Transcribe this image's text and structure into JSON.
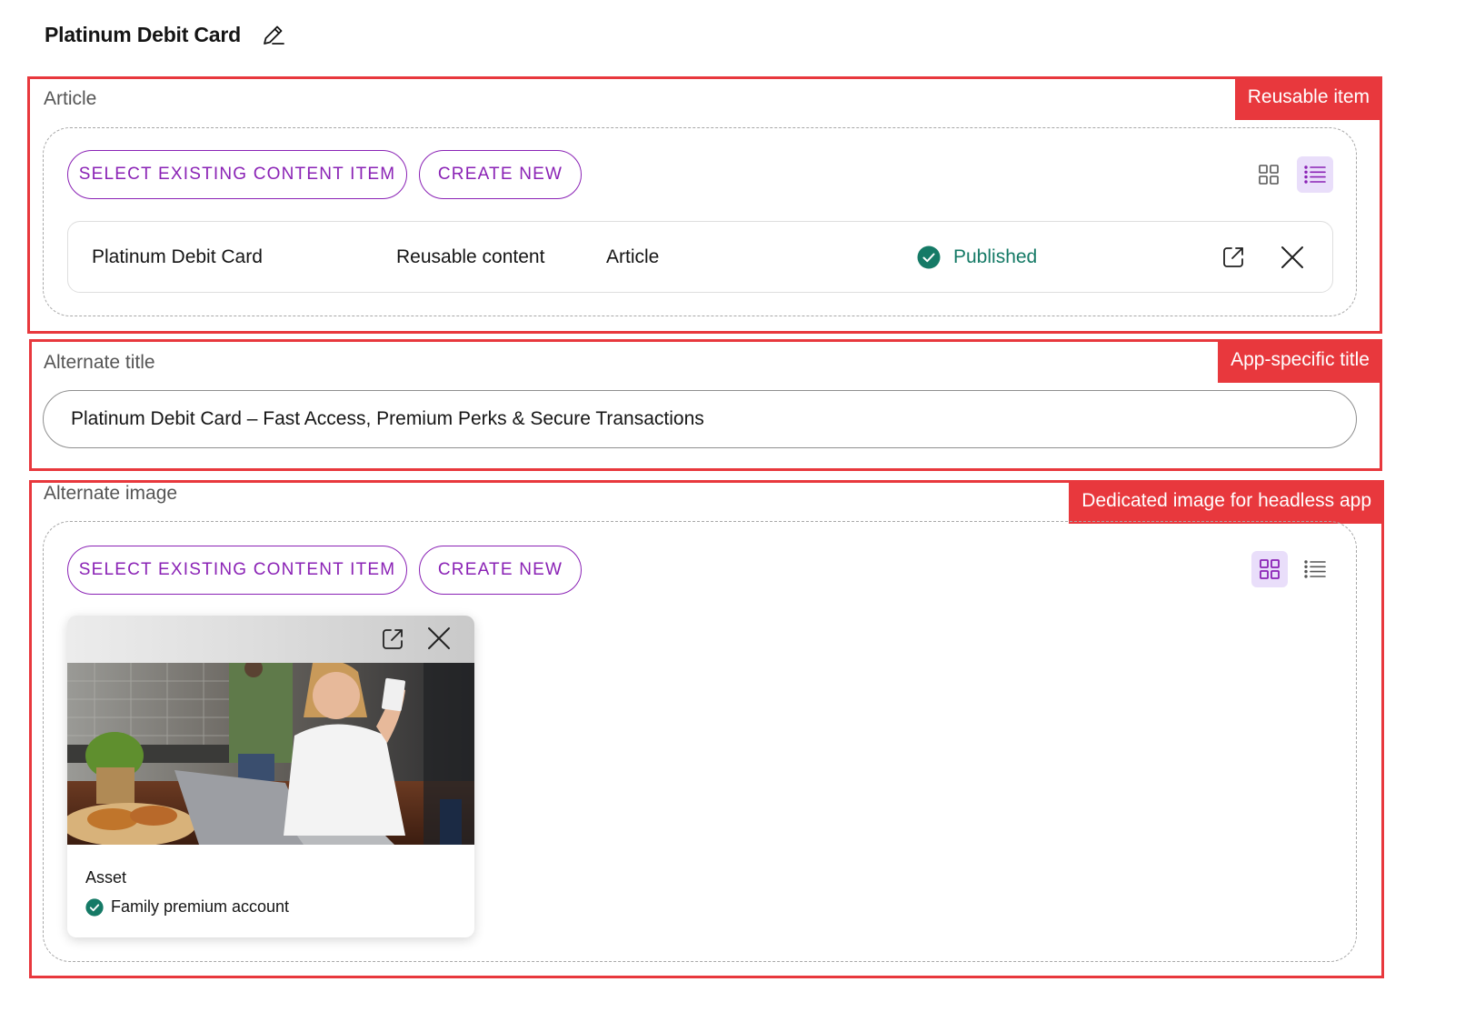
{
  "page": {
    "title": "Platinum Debit Card",
    "edit_icon": "pencil-icon"
  },
  "annotations": {
    "reusable": "Reusable item",
    "title": "App-specific title",
    "image": "Dedicated image for headless app",
    "color": "#e8383d"
  },
  "article": {
    "label": "Article",
    "select_label": "SELECT EXISTING CONTENT ITEM",
    "create_label": "CREATE NEW",
    "view_mode": "list",
    "row": {
      "name": "Platinum Debit Card",
      "content_type": "Reusable content",
      "type": "Article",
      "status": "Published",
      "open_icon": "open-external-icon",
      "remove_icon": "close-icon"
    }
  },
  "alt_title": {
    "label": "Alternate title",
    "value": "Platinum Debit Card – Fast Access, Premium Perks & Secure Transactions"
  },
  "alt_image": {
    "label": "Alternate image",
    "select_label": "SELECT EXISTING CONTENT ITEM",
    "create_label": "CREATE NEW",
    "view_mode": "grid",
    "card": {
      "type": "Asset",
      "name": "Family premium account",
      "status_icon": "check-circle-icon"
    }
  },
  "colors": {
    "accent": "#8a22b5",
    "status_green": "#157a66",
    "active_toggle_bg": "#e9defa"
  }
}
